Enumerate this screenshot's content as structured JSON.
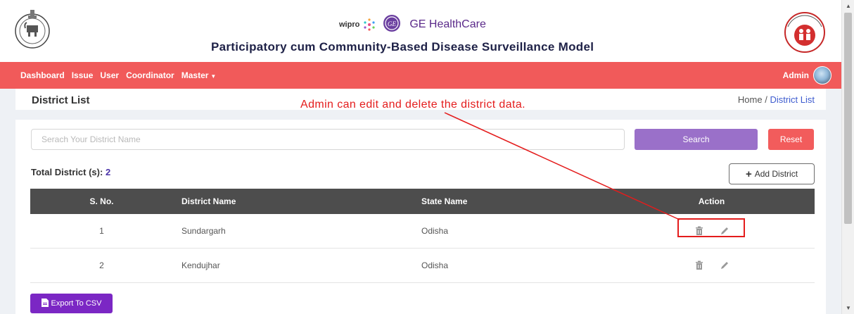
{
  "header": {
    "partner_logo_text": "wipro",
    "partner_name": "GE HealthCare",
    "title": "Participatory cum Community-Based Disease Surveillance Model"
  },
  "nav": {
    "items": [
      {
        "label": "Dashboard"
      },
      {
        "label": "Issue"
      },
      {
        "label": "User"
      },
      {
        "label": "Coordinator"
      },
      {
        "label": "Master"
      }
    ],
    "user_label": "Admin"
  },
  "page": {
    "title": "District List",
    "breadcrumb": {
      "home": "Home",
      "separator": "/",
      "current": "District List"
    }
  },
  "annotation": {
    "text": "Admin can edit and delete the district data.",
    "color": "#e41c1c"
  },
  "search": {
    "placeholder": "Serach Your District Name",
    "value": "",
    "search_label": "Search",
    "reset_label": "Reset"
  },
  "summary": {
    "total_label": "Total District (s):",
    "total_count": "2",
    "add_label": "Add District"
  },
  "table": {
    "columns": [
      "S. No.",
      "District Name",
      "State Name",
      "Action"
    ],
    "rows": [
      {
        "sno": "1",
        "district": "Sundargarh",
        "state": "Odisha"
      },
      {
        "sno": "2",
        "district": "Kendujhar",
        "state": "Odisha"
      }
    ]
  },
  "export": {
    "label": "Export To CSV"
  },
  "colors": {
    "navbar": "#f15a5a",
    "search_button": "#9a70c9",
    "reset_button": "#f25c5c",
    "export_button": "#7b27c4",
    "table_header": "#4d4d4d"
  },
  "icons": [
    "odisha-emblem-icon",
    "nhm-logo-icon",
    "wipro-logo-icon",
    "ge-logo-icon",
    "avatar",
    "trash-icon",
    "pencil-icon",
    "plus-icon",
    "file-icon",
    "caret-down-icon"
  ]
}
